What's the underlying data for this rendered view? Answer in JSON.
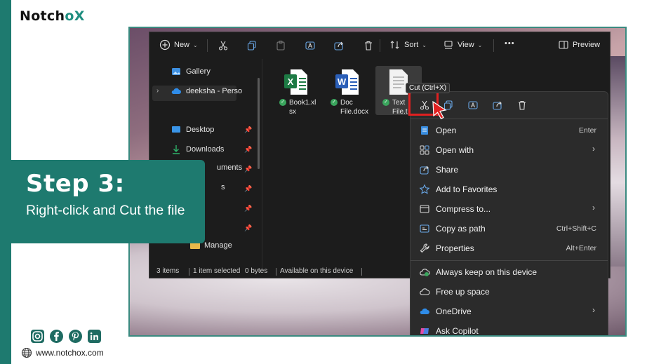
{
  "brand": {
    "logo_prefix": "Notch",
    "logo_o": "o",
    "logo_x": "X",
    "website": "www.notchox.com"
  },
  "step": {
    "title": "Step 3:",
    "subtitle": "Right-click and Cut the file"
  },
  "toolbar": {
    "new_label": "New",
    "sort_label": "Sort",
    "view_label": "View",
    "more_label": "•••",
    "preview_label": "Preview"
  },
  "sidebar": {
    "items": [
      {
        "label": "Gallery"
      },
      {
        "label": "deeksha - Perso"
      },
      {
        "label": "Desktop"
      },
      {
        "label": "Downloads"
      },
      {
        "label": "uments"
      },
      {
        "label": "s"
      },
      {
        "label": "Manage"
      }
    ]
  },
  "files": [
    {
      "name": "Book1.xlsx",
      "line1": "Book1.xl",
      "line2": "sx"
    },
    {
      "name": "Doc File.docx",
      "line1": "Doc",
      "line2": "File.docx"
    },
    {
      "name": "Text File.txt",
      "line1": "Text",
      "line2": "File.t"
    }
  ],
  "tooltip": "Cut (Ctrl+X)",
  "status": {
    "count": "3 items",
    "selected": "1 item selected",
    "size": "0 bytes",
    "availability": "Available on this device"
  },
  "context_menu": {
    "items": [
      {
        "label": "Open",
        "shortcut": "Enter"
      },
      {
        "label": "Open with",
        "arrow": "›"
      },
      {
        "label": "Share"
      },
      {
        "label": "Add to Favorites"
      },
      {
        "label": "Compress to...",
        "arrow": "›"
      },
      {
        "label": "Copy as path",
        "shortcut": "Ctrl+Shift+C"
      },
      {
        "label": "Properties",
        "shortcut": "Alt+Enter"
      },
      {
        "label": "Always keep on this device"
      },
      {
        "label": "Free up space"
      },
      {
        "label": "OneDrive",
        "arrow": "›"
      },
      {
        "label": "Ask Copilot"
      }
    ]
  },
  "colors": {
    "brand_teal": "#1e7a6f",
    "highlight_red": "#e02020",
    "explorer_bg": "#1c1c1c",
    "menu_bg": "#2b2b2b"
  }
}
